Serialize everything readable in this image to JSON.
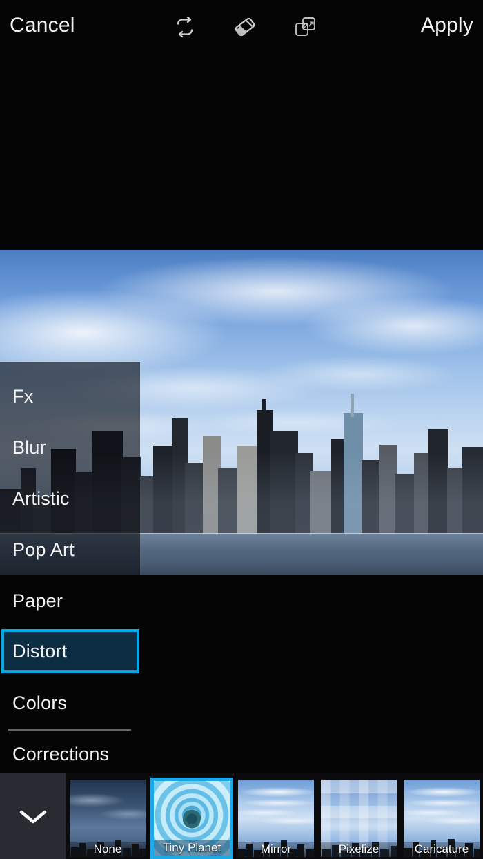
{
  "app": {
    "name": "photo-editor",
    "accent_color": "#00a8e8",
    "background_color": "#050506"
  },
  "topbar": {
    "cancel_label": "Cancel",
    "apply_label": "Apply",
    "icons": [
      {
        "name": "redo-icon",
        "label": "Redo"
      },
      {
        "name": "eraser-icon",
        "label": "Eraser"
      },
      {
        "name": "mask-icon",
        "label": "Mask"
      }
    ]
  },
  "sidebar": {
    "items": [
      {
        "label": "Fx",
        "selected": false
      },
      {
        "label": "Blur",
        "selected": false
      },
      {
        "label": "Artistic",
        "selected": false
      },
      {
        "label": "Pop Art",
        "selected": false
      },
      {
        "label": "Paper",
        "selected": false
      },
      {
        "label": "Distort",
        "selected": true
      },
      {
        "label": "Colors",
        "selected": false
      },
      {
        "label": "Corrections",
        "selected": false
      }
    ],
    "selected_item": "Distort",
    "selected_border_color": "#00a8e8",
    "selected_fill_color": "#0d2d42"
  },
  "filmstrip": {
    "collapse_icon": "chevron-down-icon",
    "selected_filter": "Tiny Planet",
    "filters": [
      {
        "label": "None",
        "selected": false,
        "highlighted": true
      },
      {
        "label": "Tiny Planet",
        "selected": true,
        "highlighted": false
      },
      {
        "label": "Mirror",
        "selected": false,
        "highlighted": false
      },
      {
        "label": "Pixelize",
        "selected": false,
        "highlighted": false
      },
      {
        "label": "Caricature",
        "selected": false,
        "highlighted": false
      },
      {
        "label": "",
        "selected": false,
        "highlighted": false
      }
    ]
  },
  "canvas": {
    "subject": "city skyline photograph",
    "description": "Manhattan skyline under blue sky with clouds"
  }
}
